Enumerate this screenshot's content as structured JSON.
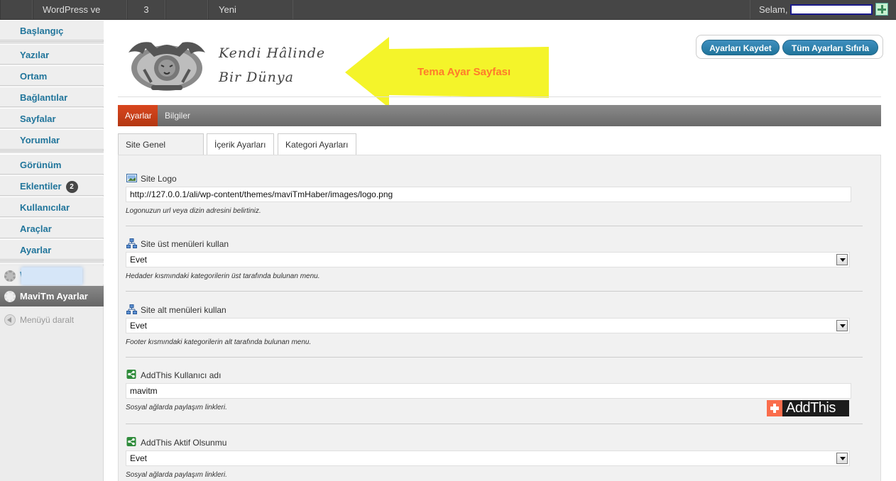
{
  "adminbar": {
    "site_name": "WordPress ve Ben",
    "comments_count": "3",
    "new_label": "Yeni",
    "greeting": "Selam,"
  },
  "sidebar": {
    "items": [
      {
        "label": "Başlangıç"
      },
      {
        "label": "Yazılar"
      },
      {
        "label": "Ortam"
      },
      {
        "label": "Bağlantılar"
      },
      {
        "label": "Sayfalar"
      },
      {
        "label": "Yorumlar"
      },
      {
        "label": "Görünüm"
      },
      {
        "label": "Eklentiler",
        "badge": "2"
      },
      {
        "label": "Kullanıcılar"
      },
      {
        "label": "Araçlar"
      },
      {
        "label": "Ayarlar"
      }
    ],
    "w_item_initial": "W",
    "active_item": "MaviTm Ayarlar",
    "collapse_label": "Menüyü daralt"
  },
  "header": {
    "tagline_line1": "Kendi Hâlinde",
    "tagline_line2": "Bir Dünya",
    "annotation": "Tema Ayar Sayfası",
    "save_button": "Ayarları Kaydet",
    "reset_button": "Tüm Ayarları Sıfırla",
    "arrow_color": "#f4f42a",
    "accent_color": "#21759b"
  },
  "tabs": {
    "main": [
      {
        "label": "Ayarlar",
        "active": true
      },
      {
        "label": "Bilgiler",
        "active": false
      }
    ],
    "sub": [
      {
        "label": "Site Genel Ayarları",
        "active": true
      },
      {
        "label": "İçerik Ayarları",
        "active": false
      },
      {
        "label": "Kategori Ayarları",
        "active": false
      }
    ]
  },
  "fields": [
    {
      "label": "Site Logo",
      "icon": "image-icon",
      "type": "text",
      "value": "http://127.0.0.1/ali/wp-content/themes/maviTmHaber/images/logo.png",
      "hint": "Logonuzun url veya dizin adresini belirtiniz."
    },
    {
      "label": "Site üst menüleri kullan",
      "icon": "sitemap-icon",
      "type": "select",
      "value": "Evet",
      "hint": "Hedader kısmındaki kategorilerin üst tarafında bulunan menu."
    },
    {
      "label": "Site alt menüleri kullan",
      "icon": "sitemap-icon",
      "type": "select",
      "value": "Evet",
      "hint": "Footer kısmındaki kategorilerin alt tarafında bulunan menu."
    },
    {
      "label": "AddThis Kullanıcı adı",
      "icon": "share-icon",
      "type": "text",
      "value": "mavitm",
      "hint": "Sosyal ağlarda paylaşım linkleri."
    },
    {
      "label": "AddThis Aktif Olsunmu",
      "icon": "share-icon",
      "type": "select",
      "value": "Evet",
      "hint": "Sosyal ağlarda paylaşım linkleri."
    }
  ],
  "addthis_logo": "AddThis"
}
